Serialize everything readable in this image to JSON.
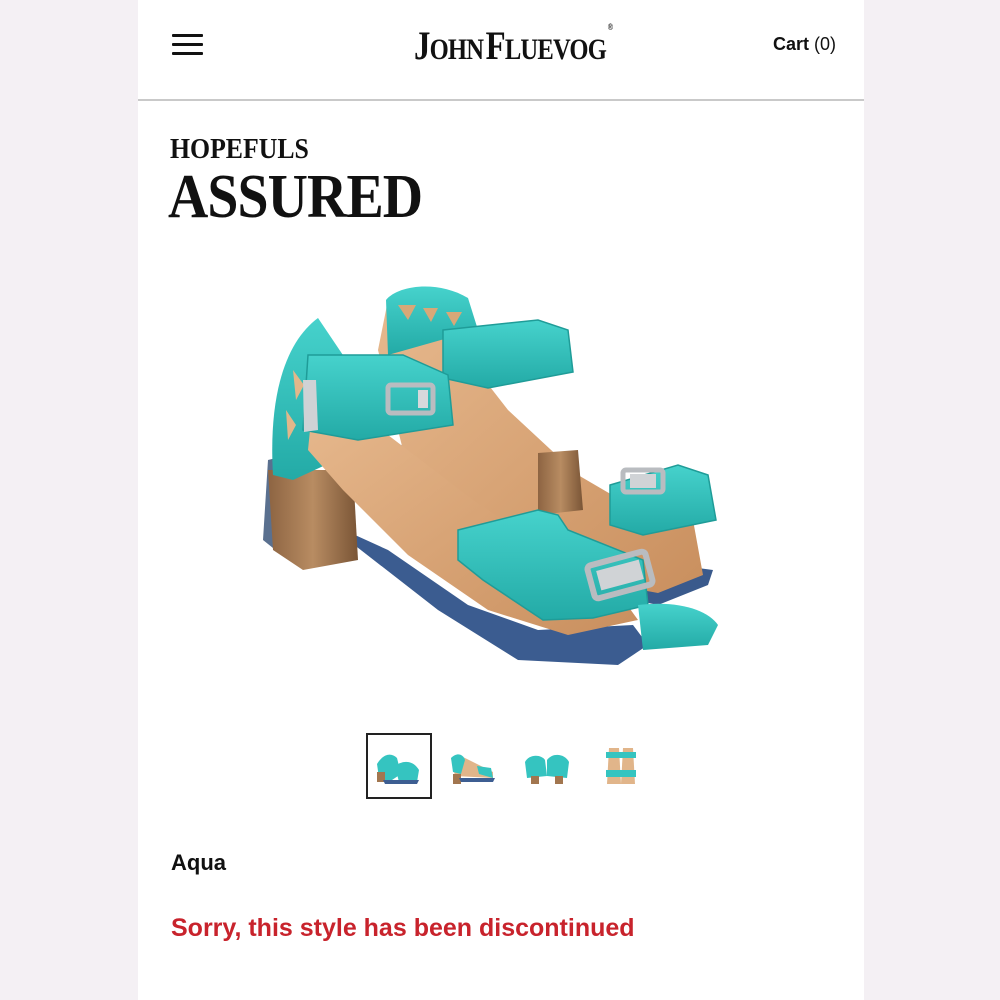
{
  "header": {
    "logo_first": "J",
    "logo_first_rest": "OHN",
    "logo_second": "F",
    "logo_second_rest": "LUEVOG",
    "logo_reg": "®",
    "cart_label": "Cart",
    "cart_count": "(0)"
  },
  "product": {
    "collection": "HOPEFULS",
    "name": "ASSURED",
    "color": "Aqua",
    "status_message": "Sorry, this style has been discontinued"
  },
  "gallery": {
    "thumbnails": [
      {
        "view": "angled-pair",
        "active": true
      },
      {
        "view": "side-profile",
        "active": false
      },
      {
        "view": "front-pair",
        "active": false
      },
      {
        "view": "top-down-pair",
        "active": false
      }
    ]
  },
  "colors": {
    "accent_red": "#c8232c",
    "aqua": "#35c4c0",
    "wood": "#a2764f",
    "sole_blue": "#3d5e92"
  },
  "icons": [
    "hamburger-menu-icon",
    "sandal-product-image"
  ]
}
